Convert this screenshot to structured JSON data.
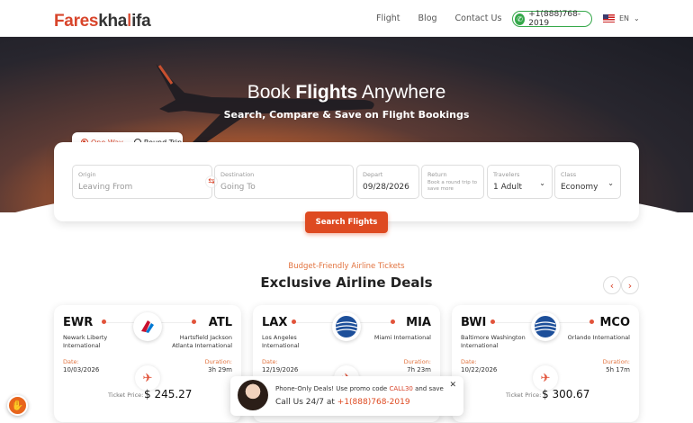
{
  "brand": {
    "logo_part1": "Fares",
    "logo_part2": "kha",
    "logo_part3": "ifa"
  },
  "nav": {
    "links": [
      "Flight",
      "Blog",
      "Contact Us"
    ],
    "phone": "+1(888)768-2019",
    "lang": "EN"
  },
  "hero": {
    "title_pre": "Book ",
    "title_bold": "Flights",
    "title_post": " Anywhere",
    "subtitle": "Search, Compare & Save on Flight Bookings"
  },
  "trip": {
    "one_way": "One Way",
    "round_trip": "Round Trip",
    "selected": "one_way"
  },
  "search": {
    "origin": {
      "label": "Origin",
      "placeholder": "Leaving From"
    },
    "destination": {
      "label": "Destination",
      "placeholder": "Going To"
    },
    "depart": {
      "label": "Depart",
      "value": "09/28/2026"
    },
    "return": {
      "label": "Return",
      "hint": "Book a round trip to save more"
    },
    "travelers": {
      "label": "Travelers",
      "value": "1 Adult"
    },
    "class": {
      "label": "Class",
      "value": "Economy"
    },
    "button": "Search Flights"
  },
  "deals": {
    "kicker": "Budget-Friendly Airline Tickets",
    "heading": "Exclusive Airline Deals",
    "date_label": "Date:",
    "duration_label": "Duration:",
    "price_label": "Ticket Price:",
    "items": [
      {
        "from": "EWR",
        "from_name": "Newark Liberty International",
        "to": "ATL",
        "to_name": "Hartsfield Jackson Atlanta International",
        "date": "10/03/2026",
        "duration": "3h 29m",
        "price": "$ 245.27",
        "airline_icon": "american-airlines-logo"
      },
      {
        "from": "LAX",
        "from_name": "Los Angeles International",
        "to": "MIA",
        "to_name": "Miami International",
        "date": "12/19/2026",
        "duration": "7h 23m",
        "price": "",
        "airline_icon": "united-airlines-logo"
      },
      {
        "from": "BWI",
        "from_name": "Baltimore Washington International",
        "to": "MCO",
        "to_name": "Orlando International",
        "date": "10/22/2026",
        "duration": "5h 17m",
        "price": "$ 300.67",
        "airline_icon": "united-airlines-logo"
      }
    ]
  },
  "toast": {
    "line1_pre": "Phone-Only Deals! Use promo code ",
    "promo": "CALL30",
    "line1_post": " and save",
    "line2_pre": "Call Us 24/7 at ",
    "phone": "+1(888)768-2019"
  },
  "colors": {
    "accent": "#de4a21",
    "green": "#35a84a"
  }
}
